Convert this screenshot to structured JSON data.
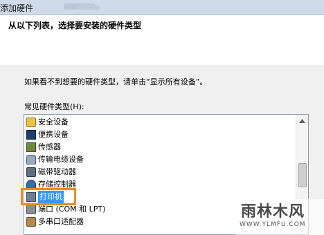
{
  "window": {
    "title": "添加硬件"
  },
  "header": {
    "title": "从以下列表，选择要安装的硬件类型"
  },
  "hint": "如果看不到想要的硬件类型，请单击“显示所有设备”。",
  "list": {
    "label": "常见硬件类型(H):",
    "selected_index": 6,
    "items": [
      {
        "label": "安全设备",
        "icon": "key-icon"
      },
      {
        "label": "便携设备",
        "icon": "portable-device-icon"
      },
      {
        "label": "传感器",
        "icon": "sensor-icon"
      },
      {
        "label": "传输电缆设备",
        "icon": "cable-device-icon"
      },
      {
        "label": "磁带驱动器",
        "icon": "tape-drive-icon"
      },
      {
        "label": "存储控制器",
        "icon": "storage-controller-icon"
      },
      {
        "label": "打印机",
        "icon": "printer-icon"
      },
      {
        "label": "端口 (COM 和 LPT)",
        "icon": "port-icon"
      },
      {
        "label": "多串口适配器",
        "icon": "multiport-adapter-icon"
      }
    ]
  },
  "annotation": {
    "highlight_color": "#f28a1e"
  },
  "watermark": {
    "logo": "雨林木风",
    "url": "WWW.YLMFU.COM"
  }
}
